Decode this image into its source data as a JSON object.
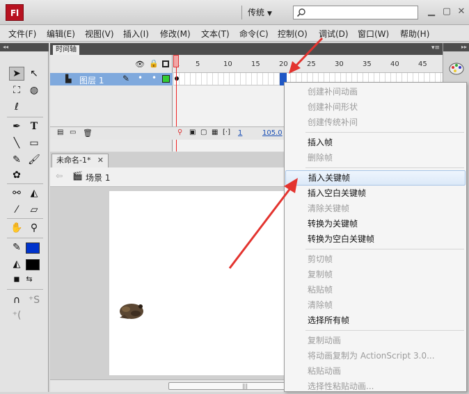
{
  "app": {
    "logo": "Fl",
    "workspace": "传统",
    "search_placeholder": ""
  },
  "menu": [
    "文件(F)",
    "编辑(E)",
    "视图(V)",
    "插入(I)",
    "修改(M)",
    "文本(T)",
    "命令(C)",
    "控制(O)",
    "调试(D)",
    "窗口(W)",
    "帮助(H)"
  ],
  "timeline": {
    "tab": "时间轴",
    "layer_name": "图层 1",
    "ticks": [
      "1",
      "5",
      "10",
      "15",
      "20",
      "25",
      "30",
      "35",
      "40",
      "45"
    ],
    "footer_frame": "1",
    "footer_fps": "105.0"
  },
  "document": {
    "tab": "未命名-1*",
    "scene": "场景 1"
  },
  "context_menu": {
    "items": [
      {
        "label": "创建补间动画",
        "enabled": false
      },
      {
        "label": "创建补间形状",
        "enabled": false
      },
      {
        "label": "创建传统补间",
        "enabled": false
      },
      {
        "label": "插入帧",
        "enabled": true
      },
      {
        "label": "删除帧",
        "enabled": false
      },
      {
        "label": "插入关键帧",
        "enabled": true,
        "hover": true
      },
      {
        "label": "插入空白关键帧",
        "enabled": true
      },
      {
        "label": "清除关键帧",
        "enabled": false
      },
      {
        "label": "转换为关键帧",
        "enabled": true
      },
      {
        "label": "转换为空白关键帧",
        "enabled": true
      },
      {
        "label": "剪切帧",
        "enabled": false
      },
      {
        "label": "复制帧",
        "enabled": false
      },
      {
        "label": "粘贴帧",
        "enabled": false
      },
      {
        "label": "清除帧",
        "enabled": false
      },
      {
        "label": "选择所有帧",
        "enabled": true
      },
      {
        "label": "复制动画",
        "enabled": false
      },
      {
        "label": "将动画复制为 ActionScript 3.0...",
        "enabled": false
      },
      {
        "label": "粘贴动画",
        "enabled": false
      },
      {
        "label": "选择性粘贴动画...",
        "enabled": false
      }
    ]
  },
  "colors": {
    "stroke": "#0033cc",
    "fill": "#000000",
    "layer_color": "#33cc33",
    "accent": "#e3342f"
  },
  "icons": [
    "search-icon",
    "eye-icon",
    "lock-icon",
    "outline-icon",
    "pencil-icon",
    "palette-icon",
    "scene-icon",
    "trash-icon"
  ]
}
